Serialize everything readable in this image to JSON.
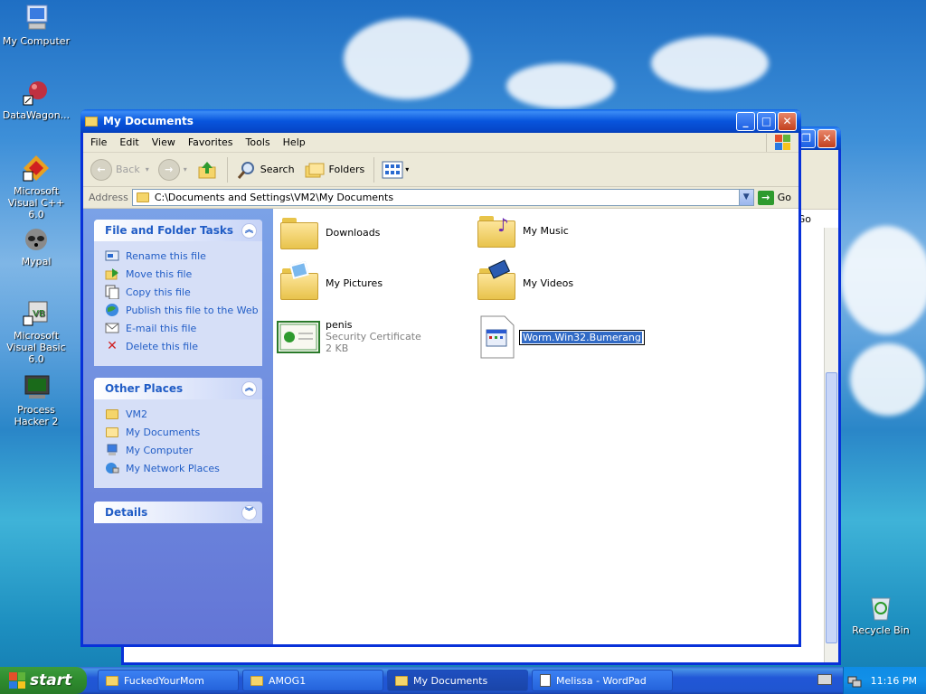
{
  "desktop": {
    "icons": [
      {
        "label": "My Computer"
      },
      {
        "label": "DataWagon..."
      },
      {
        "label": "Microsoft Visual C++ 6.0"
      },
      {
        "label": "Mypal"
      },
      {
        "label": "Microsoft Visual Basic 6.0"
      },
      {
        "label": "Process Hacker 2"
      },
      {
        "label": "Recycle Bin"
      }
    ]
  },
  "back_window": {
    "go_label": "Go"
  },
  "window": {
    "title": "My Documents",
    "menu": [
      "File",
      "Edit",
      "View",
      "Favorites",
      "Tools",
      "Help"
    ],
    "toolbar": {
      "back_label": "Back",
      "search_label": "Search",
      "folders_label": "Folders"
    },
    "address": {
      "label": "Address",
      "value": "C:\\Documents and Settings\\VM2\\My Documents",
      "go_label": "Go"
    },
    "task_pane": {
      "file_tasks": {
        "title": "File and Folder Tasks",
        "items": [
          "Rename this file",
          "Move this file",
          "Copy this file",
          "Publish this file to the Web",
          "E-mail this file",
          "Delete this file"
        ]
      },
      "other_places": {
        "title": "Other Places",
        "items": [
          "VM2",
          "My Documents",
          "My Computer",
          "My Network Places"
        ]
      },
      "details": {
        "title": "Details"
      }
    },
    "files": {
      "downloads": "Downloads",
      "my_music": "My Music",
      "my_pictures": "My Pictures",
      "my_videos": "My Videos",
      "penis": {
        "name": "penis",
        "type": "Security Certificate",
        "size": "2 KB"
      },
      "rename_value": "Worm.Win32.Bumerang"
    }
  },
  "taskbar": {
    "start_label": "start",
    "items": [
      "FuckedYourMom",
      "AMOG1",
      "My Documents",
      "Melissa - WordPad"
    ],
    "active_index": 2,
    "clock": "11:16 PM"
  },
  "colors": {
    "title_blue": "#0855dd",
    "link_blue": "#215dc6",
    "taskbar_blue": "#2157d7",
    "start_green": "#2e8b2e"
  }
}
